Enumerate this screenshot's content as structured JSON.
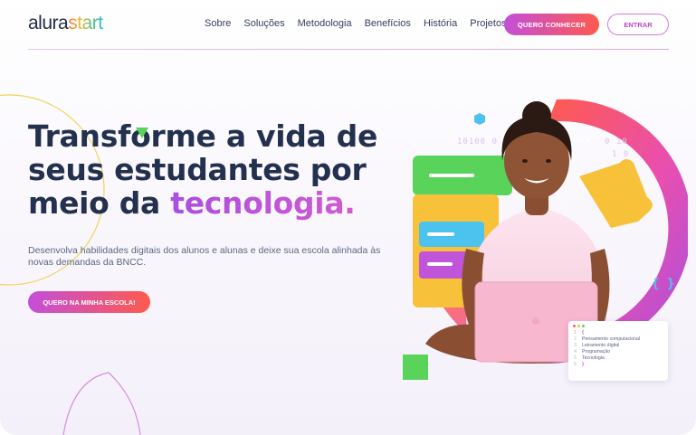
{
  "header": {
    "logo_part1": "alura",
    "logo_part2": "start",
    "nav": [
      "Sobre",
      "Soluções",
      "Metodologia",
      "Benefícios",
      "História",
      "Projetos"
    ],
    "cta_primary": "QUERO CONHECER",
    "cta_secondary": "ENTRAR"
  },
  "hero": {
    "title_line1": "Transforme a vida de",
    "title_line2": "seus estudantes por",
    "title_line3_pre": "meio da ",
    "title_highlight": "tecnologia.",
    "description": "Desenvolva habilidades digitais dos alunos e alunas e deixe sua escola alinhada às novas demandas da BNCC.",
    "cta": "QUERO NA MINHA ESCOLA!"
  },
  "illustration": {
    "binary_top": "10100 0",
    "binary_right": "0 10",
    "binary_right2": "1 0",
    "code_icon": "</>",
    "braces_icon": "{ }",
    "code_card": {
      "open_brace": "{",
      "close_brace": "}",
      "lines": [
        "Pensamento computacional",
        "Letramento digital",
        "Programação",
        "Tecnologia"
      ],
      "line_numbers": [
        "1",
        "2",
        "3",
        "4",
        "5",
        "6"
      ]
    }
  },
  "colors": {
    "brand_dark": "#23314e",
    "gradient_start": "#c34fd9",
    "gradient_end": "#ff5a4e",
    "accent_green": "#5ad35a",
    "accent_yellow": "#f7c23a",
    "accent_blue": "#4cc3ef"
  }
}
